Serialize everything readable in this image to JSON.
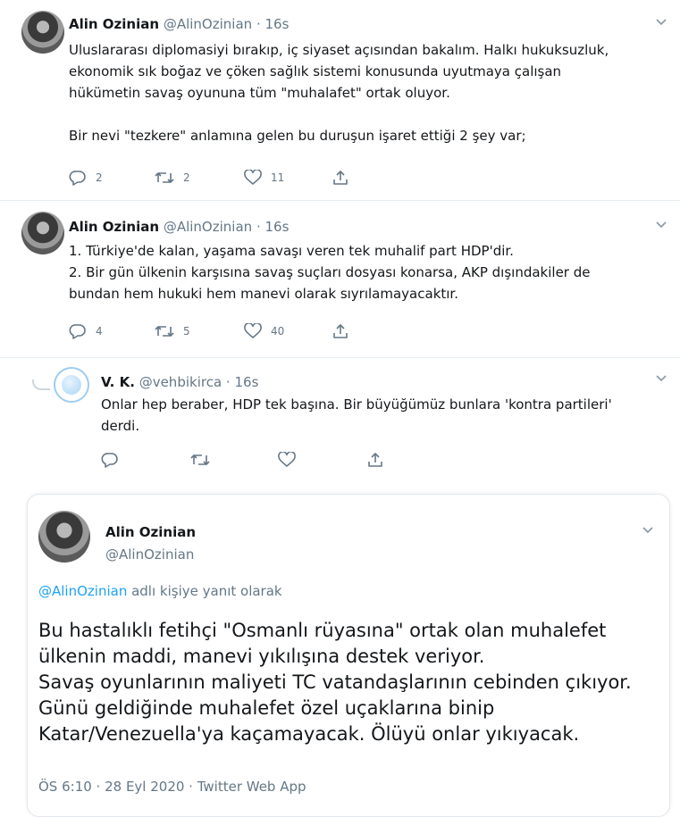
{
  "tweets": [
    {
      "name": "Alin Ozinian",
      "handle": "@AlinOzinian",
      "dot": "·",
      "time": "16s",
      "lines": [
        "Uluslararası diplomasiyi bırakıp, iç siyaset açısından bakalım. Halkı hukuksuzluk,",
        "ekonomik sık boğaz ve çöken sağlık sistemi konusunda uyutmaya çalışan",
        "hükümetin savaş oyununa tüm \"muhalafet\" ortak oluyor.",
        "",
        "Bir nevi \"tezkere\" anlamına gelen bu duruşun işaret ettiği 2 şey var;"
      ],
      "replies": "2",
      "retweets": "2",
      "likes": "11"
    },
    {
      "name": "Alin Ozinian",
      "handle": "@AlinOzinian",
      "dot": "·",
      "time": "16s",
      "lines": [
        "1. Türkiye'de kalan, yaşama savaşı veren tek muhalif part HDP'dir.",
        "2. Bir gün ülkenin karşısına savaş suçları dosyası konarsa, AKP dışındakiler de",
        "bundan hem hukuki hem manevi olarak sıyrılamayacaktır."
      ],
      "replies": "4",
      "retweets": "5",
      "likes": "40"
    },
    {
      "name": "V. K.",
      "handle": "@vehbikirca",
      "dot": "·",
      "time": "16s",
      "lines": [
        "Onlar hep beraber, HDP tek başına. Bir büyüğümüz bunlara 'kontra partileri'",
        "derdi."
      ]
    }
  ],
  "main": {
    "name": "Alin Ozinian",
    "handle": "@AlinOzinian",
    "reply_link": "@AlinOzinian",
    "reply_suffix": " adlı kişiye yanıt olarak",
    "lines": [
      "Bu hastalıklı fetihçi \"Osmanlı rüyasına\" ortak olan muhalefet",
      "ülkenin maddi, manevi yıkılışına destek veriyor.",
      "Savaş oyunlarının maliyeti TC vatandaşlarının cebinden çıkıyor.",
      "Günü geldiğinde muhalefet özel uçaklarına binip",
      "Katar/Venezuella'ya kaçamayacak. Ölüyü onlar yıkıyacak."
    ],
    "meta": "ÖS 6:10 · 28 Eyl 2020 · Twitter Web App"
  },
  "icons": {
    "reply": "reply-icon",
    "retweet": "retweet-icon",
    "like": "like-icon",
    "share": "share-icon",
    "more": "chevron-down-icon"
  },
  "colors": {
    "link": "#1da1f2",
    "muted": "#657786",
    "text": "#14171a",
    "thread_line": "#ccd6dd"
  }
}
